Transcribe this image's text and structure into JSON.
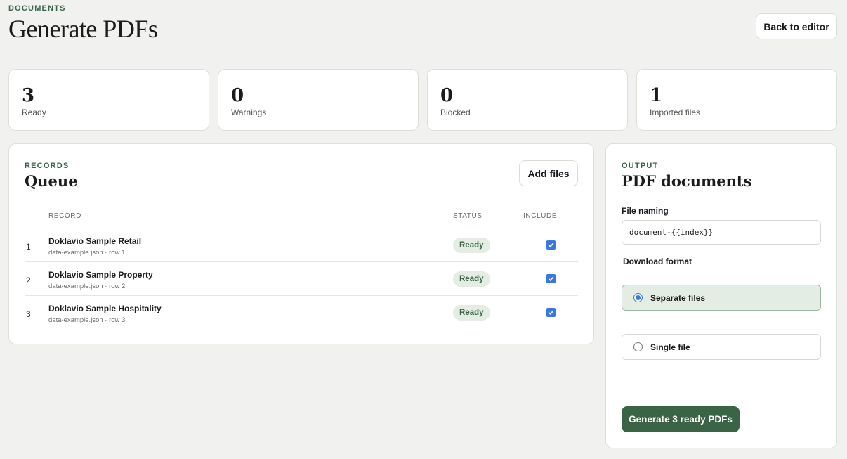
{
  "header": {
    "eyebrow": "DOCUMENTS",
    "title": "Generate PDFs",
    "back_label": "Back to editor"
  },
  "stats": [
    {
      "value": "3",
      "label": "Ready"
    },
    {
      "value": "0",
      "label": "Warnings"
    },
    {
      "value": "0",
      "label": "Blocked"
    },
    {
      "value": "1",
      "label": "Imported files"
    }
  ],
  "queue": {
    "eyebrow": "RECORDS",
    "title": "Queue",
    "add_files_label": "Add files",
    "columns": {
      "record": "RECORD",
      "status": "STATUS",
      "include": "INCLUDE"
    },
    "rows": [
      {
        "index": "1",
        "title": "Doklavio Sample Retail",
        "source": "data-example.json · row 1",
        "status": "Ready",
        "included": true
      },
      {
        "index": "2",
        "title": "Doklavio Sample Property",
        "source": "data-example.json · row 2",
        "status": "Ready",
        "included": true
      },
      {
        "index": "3",
        "title": "Doklavio Sample Hospitality",
        "source": "data-example.json · row 3",
        "status": "Ready",
        "included": true
      }
    ]
  },
  "output": {
    "eyebrow": "OUTPUT",
    "title": "PDF documents",
    "file_naming_label": "File naming",
    "file_naming_value": "document-{{index}}",
    "download_format_label": "Download format",
    "options": [
      {
        "label": "Separate files",
        "selected": true
      },
      {
        "label": "Single file",
        "selected": false
      }
    ],
    "generate_label": "Generate 3 ready PDFs"
  },
  "colors": {
    "accent": "#3b6447",
    "background": "#f1f1ef",
    "checkbox": "#3a78e0"
  }
}
